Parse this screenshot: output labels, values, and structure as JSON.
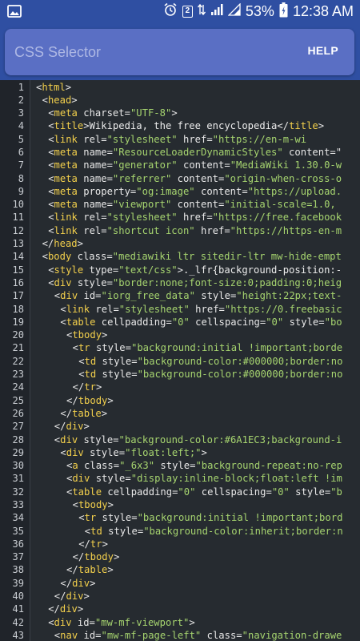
{
  "status_bar": {
    "battery_percent": "53%",
    "time": "12:38 AM",
    "sim_label": "2"
  },
  "app_bar": {
    "search_placeholder": "CSS Selector",
    "help_label": "HELP"
  },
  "colors": {
    "app_bar": "#2f4fa2",
    "search_field": "#5a6fc4",
    "code_background": "#262b30",
    "tag_name": "#f3d04c",
    "attr_value": "#a6d46f"
  },
  "code_lines": [
    {
      "n": "1",
      "i": 0,
      "t": [
        [
          "tg",
          "<"
        ],
        [
          "tn",
          "html"
        ],
        [
          "tg",
          ">"
        ]
      ]
    },
    {
      "n": "2",
      "i": 1,
      "t": [
        [
          "tg",
          "<"
        ],
        [
          "tn",
          "head"
        ],
        [
          "tg",
          ">"
        ]
      ]
    },
    {
      "n": "3",
      "i": 2,
      "t": [
        [
          "tg",
          "<"
        ],
        [
          "tn",
          "meta"
        ],
        [
          "at",
          " charset="
        ],
        [
          "av",
          "\"UTF-8\""
        ],
        [
          "tg",
          ">"
        ]
      ]
    },
    {
      "n": "4",
      "i": 2,
      "t": [
        [
          "tg",
          "<"
        ],
        [
          "tn",
          "title"
        ],
        [
          "tg",
          ">"
        ],
        [
          "tx",
          "Wikipedia, the free encyclopedia"
        ],
        [
          "tg",
          "</"
        ],
        [
          "tn",
          "title"
        ],
        [
          "tg",
          ">"
        ]
      ]
    },
    {
      "n": "5",
      "i": 2,
      "t": [
        [
          "tg",
          "<"
        ],
        [
          "tn",
          "link"
        ],
        [
          "at",
          " rel="
        ],
        [
          "av",
          "\"stylesheet\""
        ],
        [
          "at",
          " href="
        ],
        [
          "av",
          "\"https://en-m-wi"
        ]
      ]
    },
    {
      "n": "6",
      "i": 2,
      "t": [
        [
          "tg",
          "<"
        ],
        [
          "tn",
          "meta"
        ],
        [
          "at",
          " name="
        ],
        [
          "av",
          "\"ResourceLoaderDynamicStyles\""
        ],
        [
          "at",
          " content=\""
        ]
      ]
    },
    {
      "n": "7",
      "i": 2,
      "t": [
        [
          "tg",
          "<"
        ],
        [
          "tn",
          "meta"
        ],
        [
          "at",
          " name="
        ],
        [
          "av",
          "\"generator\""
        ],
        [
          "at",
          " content="
        ],
        [
          "av",
          "\"MediaWiki 1.30.0-w"
        ]
      ]
    },
    {
      "n": "8",
      "i": 2,
      "t": [
        [
          "tg",
          "<"
        ],
        [
          "tn",
          "meta"
        ],
        [
          "at",
          " name="
        ],
        [
          "av",
          "\"referrer\""
        ],
        [
          "at",
          " content="
        ],
        [
          "av",
          "\"origin-when-cross-o"
        ]
      ]
    },
    {
      "n": "9",
      "i": 2,
      "t": [
        [
          "tg",
          "<"
        ],
        [
          "tn",
          "meta"
        ],
        [
          "at",
          " property="
        ],
        [
          "av",
          "\"og:image\""
        ],
        [
          "at",
          " content="
        ],
        [
          "av",
          "\"https://upload."
        ]
      ]
    },
    {
      "n": "10",
      "i": 2,
      "t": [
        [
          "tg",
          "<"
        ],
        [
          "tn",
          "meta"
        ],
        [
          "at",
          " name="
        ],
        [
          "av",
          "\"viewport\""
        ],
        [
          "at",
          " content="
        ],
        [
          "av",
          "\"initial-scale=1.0,"
        ]
      ]
    },
    {
      "n": "11",
      "i": 2,
      "t": [
        [
          "tg",
          "<"
        ],
        [
          "tn",
          "link"
        ],
        [
          "at",
          " rel="
        ],
        [
          "av",
          "\"stylesheet\""
        ],
        [
          "at",
          " href="
        ],
        [
          "av",
          "\"https://free.facebook"
        ]
      ]
    },
    {
      "n": "12",
      "i": 2,
      "t": [
        [
          "tg",
          "<"
        ],
        [
          "tn",
          "link"
        ],
        [
          "at",
          " rel="
        ],
        [
          "av",
          "\"shortcut icon\""
        ],
        [
          "at",
          " href="
        ],
        [
          "av",
          "\"https://https-en-m"
        ]
      ]
    },
    {
      "n": "13",
      "i": 1,
      "t": [
        [
          "tg",
          "</"
        ],
        [
          "tn",
          "head"
        ],
        [
          "tg",
          ">"
        ]
      ]
    },
    {
      "n": "14",
      "i": 1,
      "t": [
        [
          "tg",
          "<"
        ],
        [
          "tn",
          "body"
        ],
        [
          "at",
          " class="
        ],
        [
          "av",
          "\"mediawiki ltr sitedir-ltr mw-hide-empt"
        ]
      ]
    },
    {
      "n": "15",
      "i": 2,
      "t": [
        [
          "tg",
          "<"
        ],
        [
          "tn",
          "style"
        ],
        [
          "at",
          " type="
        ],
        [
          "av",
          "\"text/css\""
        ],
        [
          "tg",
          ">"
        ],
        [
          "tx",
          "._lfr{background-position:-"
        ]
      ]
    },
    {
      "n": "16",
      "i": 2,
      "t": [
        [
          "tg",
          "<"
        ],
        [
          "tn",
          "div"
        ],
        [
          "at",
          " style="
        ],
        [
          "av",
          "\"border:none;font-size:0;padding:0;heig"
        ]
      ]
    },
    {
      "n": "17",
      "i": 3,
      "t": [
        [
          "tg",
          "<"
        ],
        [
          "tn",
          "div"
        ],
        [
          "at",
          " id="
        ],
        [
          "av",
          "\"iorg_free_data\""
        ],
        [
          "at",
          " style="
        ],
        [
          "av",
          "\"height:22px;text-"
        ]
      ]
    },
    {
      "n": "18",
      "i": 4,
      "t": [
        [
          "tg",
          "<"
        ],
        [
          "tn",
          "link"
        ],
        [
          "at",
          " rel="
        ],
        [
          "av",
          "\"stylesheet\""
        ],
        [
          "at",
          " href="
        ],
        [
          "av",
          "\"https://0.freebasic"
        ]
      ]
    },
    {
      "n": "19",
      "i": 4,
      "t": [
        [
          "tg",
          "<"
        ],
        [
          "tn",
          "table"
        ],
        [
          "at",
          " cellpadding="
        ],
        [
          "av",
          "\"0\""
        ],
        [
          "at",
          " cellspacing="
        ],
        [
          "av",
          "\"0\""
        ],
        [
          "at",
          " style="
        ],
        [
          "av",
          "\"bo"
        ]
      ]
    },
    {
      "n": "20",
      "i": 5,
      "t": [
        [
          "tg",
          "<"
        ],
        [
          "tn",
          "tbody"
        ],
        [
          "tg",
          ">"
        ]
      ]
    },
    {
      "n": "21",
      "i": 6,
      "t": [
        [
          "tg",
          "<"
        ],
        [
          "tn",
          "tr"
        ],
        [
          "at",
          " style="
        ],
        [
          "av",
          "\"background:initial !important;borde"
        ]
      ]
    },
    {
      "n": "22",
      "i": 7,
      "t": [
        [
          "tg",
          "<"
        ],
        [
          "tn",
          "td"
        ],
        [
          "at",
          " style="
        ],
        [
          "av",
          "\"background-color:#000000;border:no"
        ]
      ]
    },
    {
      "n": "23",
      "i": 7,
      "t": [
        [
          "tg",
          "<"
        ],
        [
          "tn",
          "td"
        ],
        [
          "at",
          " style="
        ],
        [
          "av",
          "\"background-color:#000000;border:no"
        ]
      ]
    },
    {
      "n": "24",
      "i": 6,
      "t": [
        [
          "tg",
          "</"
        ],
        [
          "tn",
          "tr"
        ],
        [
          "tg",
          ">"
        ]
      ]
    },
    {
      "n": "25",
      "i": 5,
      "t": [
        [
          "tg",
          "</"
        ],
        [
          "tn",
          "tbody"
        ],
        [
          "tg",
          ">"
        ]
      ]
    },
    {
      "n": "26",
      "i": 4,
      "t": [
        [
          "tg",
          "</"
        ],
        [
          "tn",
          "table"
        ],
        [
          "tg",
          ">"
        ]
      ]
    },
    {
      "n": "27",
      "i": 3,
      "t": [
        [
          "tg",
          "</"
        ],
        [
          "tn",
          "div"
        ],
        [
          "tg",
          ">"
        ]
      ]
    },
    {
      "n": "28",
      "i": 3,
      "t": [
        [
          "tg",
          "<"
        ],
        [
          "tn",
          "div"
        ],
        [
          "at",
          " style="
        ],
        [
          "av",
          "\"background-color:#6A1EC3;background-i"
        ]
      ]
    },
    {
      "n": "29",
      "i": 4,
      "t": [
        [
          "tg",
          "<"
        ],
        [
          "tn",
          "div"
        ],
        [
          "at",
          " style="
        ],
        [
          "av",
          "\"float:left;\""
        ],
        [
          "tg",
          ">"
        ]
      ]
    },
    {
      "n": "30",
      "i": 5,
      "t": [
        [
          "tg",
          "<"
        ],
        [
          "tn",
          "a"
        ],
        [
          "at",
          " class="
        ],
        [
          "av",
          "\"_6x3\""
        ],
        [
          "at",
          " style="
        ],
        [
          "av",
          "\"background-repeat:no-rep"
        ]
      ]
    },
    {
      "n": "31",
      "i": 5,
      "t": [
        [
          "tg",
          "<"
        ],
        [
          "tn",
          "div"
        ],
        [
          "at",
          " style="
        ],
        [
          "av",
          "\"display:inline-block;float:left !im"
        ]
      ]
    },
    {
      "n": "32",
      "i": 5,
      "t": [
        [
          "tg",
          "<"
        ],
        [
          "tn",
          "table"
        ],
        [
          "at",
          " cellpadding="
        ],
        [
          "av",
          "\"0\""
        ],
        [
          "at",
          " cellspacing="
        ],
        [
          "av",
          "\"0\""
        ],
        [
          "at",
          " style="
        ],
        [
          "av",
          "\"b"
        ]
      ]
    },
    {
      "n": "33",
      "i": 6,
      "t": [
        [
          "tg",
          "<"
        ],
        [
          "tn",
          "tbody"
        ],
        [
          "tg",
          ">"
        ]
      ]
    },
    {
      "n": "34",
      "i": 7,
      "t": [
        [
          "tg",
          "<"
        ],
        [
          "tn",
          "tr"
        ],
        [
          "at",
          " style="
        ],
        [
          "av",
          "\"background:initial !important;bord"
        ]
      ]
    },
    {
      "n": "35",
      "i": 8,
      "t": [
        [
          "tg",
          "<"
        ],
        [
          "tn",
          "td"
        ],
        [
          "at",
          " style="
        ],
        [
          "av",
          "\"background-color:inherit;border:n"
        ]
      ]
    },
    {
      "n": "36",
      "i": 7,
      "t": [
        [
          "tg",
          "</"
        ],
        [
          "tn",
          "tr"
        ],
        [
          "tg",
          ">"
        ]
      ]
    },
    {
      "n": "37",
      "i": 6,
      "t": [
        [
          "tg",
          "</"
        ],
        [
          "tn",
          "tbody"
        ],
        [
          "tg",
          ">"
        ]
      ]
    },
    {
      "n": "38",
      "i": 5,
      "t": [
        [
          "tg",
          "</"
        ],
        [
          "tn",
          "table"
        ],
        [
          "tg",
          ">"
        ]
      ]
    },
    {
      "n": "39",
      "i": 4,
      "t": [
        [
          "tg",
          "</"
        ],
        [
          "tn",
          "div"
        ],
        [
          "tg",
          ">"
        ]
      ]
    },
    {
      "n": "40",
      "i": 3,
      "t": [
        [
          "tg",
          "</"
        ],
        [
          "tn",
          "div"
        ],
        [
          "tg",
          ">"
        ]
      ]
    },
    {
      "n": "41",
      "i": 2,
      "t": [
        [
          "tg",
          "</"
        ],
        [
          "tn",
          "div"
        ],
        [
          "tg",
          ">"
        ]
      ]
    },
    {
      "n": "42",
      "i": 2,
      "t": [
        [
          "tg",
          "<"
        ],
        [
          "tn",
          "div"
        ],
        [
          "at",
          " id="
        ],
        [
          "av",
          "\"mw-mf-viewport\""
        ],
        [
          "tg",
          ">"
        ]
      ]
    },
    {
      "n": "43",
      "i": 3,
      "t": [
        [
          "tg",
          "<"
        ],
        [
          "tn",
          "nav"
        ],
        [
          "at",
          " id="
        ],
        [
          "av",
          "\"mw-mf-page-left\""
        ],
        [
          "at",
          " class="
        ],
        [
          "av",
          "\"navigation-drawe"
        ]
      ]
    }
  ]
}
